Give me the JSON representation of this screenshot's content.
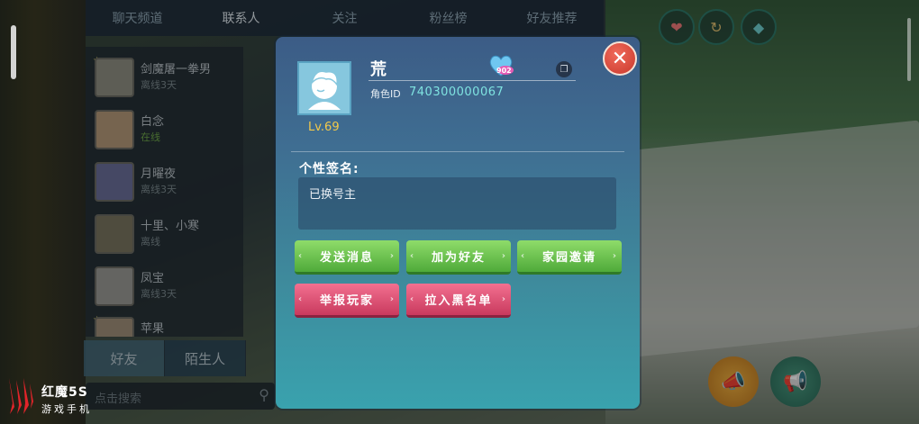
{
  "top_tabs": [
    "聊天频道",
    "联系人",
    "关注",
    "粉丝榜",
    "好友推荐"
  ],
  "friends": [
    {
      "name": "剑魔屠一拳男",
      "status": "离线3天",
      "online": false
    },
    {
      "name": "白念",
      "status": "在线",
      "online": true
    },
    {
      "name": "月曜夜",
      "status": "离线3天",
      "online": false
    },
    {
      "name": "十里、小寒",
      "status": "离线",
      "online": false
    },
    {
      "name": "凤宝",
      "status": "离线3天",
      "online": false
    },
    {
      "name": "苹果",
      "status": "",
      "online": false
    }
  ],
  "bottom_tabs": {
    "friends": "好友",
    "strangers": "陌生人"
  },
  "search": {
    "placeholder": "点击搜索"
  },
  "profile": {
    "name": "荒",
    "level": "Lv.69",
    "heart_count": "902",
    "id_label": "角色ID",
    "id_value": "740300000067",
    "signature_title": "个性签名:",
    "signature": "已换号主"
  },
  "actions": {
    "send_message": "发送消息",
    "add_friend": "加为好友",
    "home_invite": "家园邀请",
    "report_player": "举报玩家",
    "blacklist": "拉入黑名单"
  },
  "branding": {
    "name": "红魔5S",
    "sub": "游戏手机"
  },
  "colors": {
    "green_button": "#5cb845",
    "red_button": "#d94a6e",
    "level": "#f2c94a",
    "id": "#7fe3e0"
  }
}
